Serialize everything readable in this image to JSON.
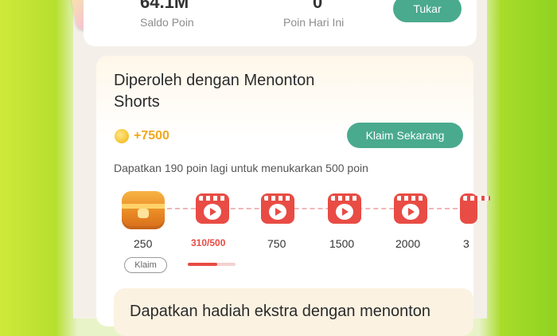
{
  "top": {
    "saldo_value": "64.1M",
    "saldo_label": "Saldo Poin",
    "today_value": "0",
    "today_label": "Poin Hari Ini",
    "tukar_label": "Tukar"
  },
  "task": {
    "title": "Diperoleh dengan Menonton Shorts",
    "reward": "+7500",
    "claim_button": "Klaim Sekarang",
    "hint": "Dapatkan 190 poin lagi untuk menukarkan 500 poin"
  },
  "steps": [
    {
      "label": "250",
      "type": "chest"
    },
    {
      "label": "310/500",
      "type": "video"
    },
    {
      "label": "750",
      "type": "video"
    },
    {
      "label": "1500",
      "type": "video"
    },
    {
      "label": "2000",
      "type": "video"
    },
    {
      "label": "3",
      "type": "video"
    }
  ],
  "progress_fraction": 0.62,
  "claim_chip": "Klaim",
  "bonus_text": "Dapatkan hadiah ekstra dengan menonton",
  "colors": {
    "accent_green": "#4aaa8e",
    "accent_red": "#e84c44",
    "coin_orange": "#f0a81c"
  },
  "icons": {
    "coin": "coin-icon",
    "chest": "treasure-chest-icon",
    "video": "video-play-icon",
    "gift": "gift-box-icon"
  }
}
